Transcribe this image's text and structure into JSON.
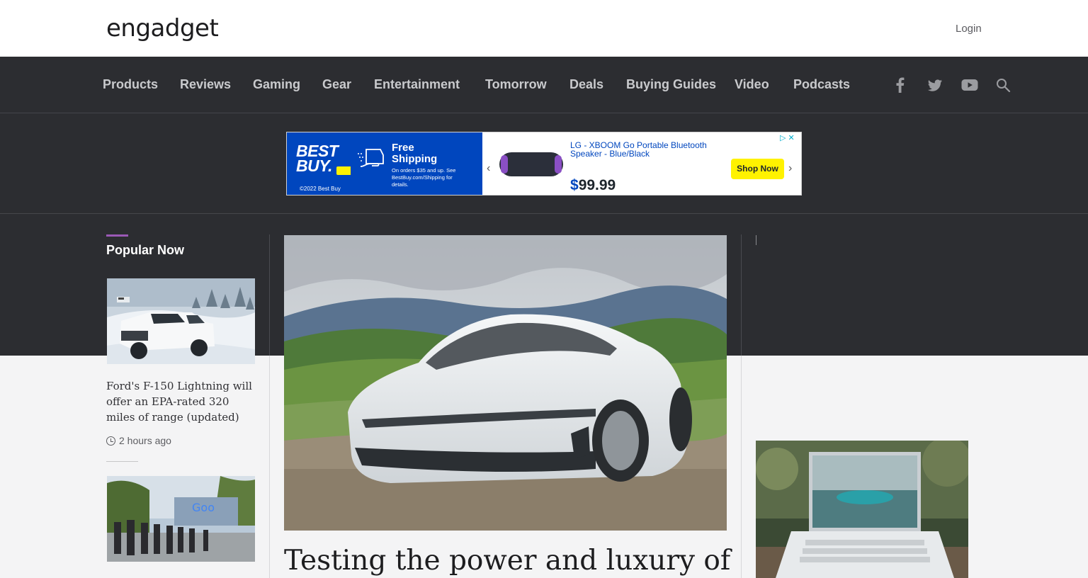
{
  "header": {
    "logo": "engadget",
    "login_label": "Login"
  },
  "nav": {
    "items": [
      "Products",
      "Reviews",
      "Gaming",
      "Gear",
      "Entertainment",
      "Tomorrow",
      "Deals",
      "Buying Guides",
      "Video",
      "Podcasts"
    ],
    "social_icons": [
      "facebook-icon",
      "twitter-icon",
      "youtube-icon",
      "search-icon"
    ]
  },
  "ad": {
    "brand_line1": "BEST",
    "brand_line2": "BUY.",
    "copyright": "©2022 Best Buy",
    "shipping_title": "Free Shipping",
    "shipping_detail": "On orders $35 and up. See BestBuy.com/Shipping for details.",
    "product": "LG - XBOOM Go Portable Bluetooth Speaker - Blue/Black",
    "price_symbol": "$",
    "price_value": "99.99",
    "cta": "Shop Now",
    "brand_color": "#0046be",
    "cta_color": "#fff200"
  },
  "popular": {
    "title": "Popular Now",
    "accent_color": "#9b59b6",
    "stories": [
      {
        "title": "Ford's F-150 Lightning will offer an EPA-rated 320 miles of range (updated)",
        "time": "2 hours ago"
      }
    ]
  },
  "hero": {
    "title": "Testing the power and luxury of"
  }
}
